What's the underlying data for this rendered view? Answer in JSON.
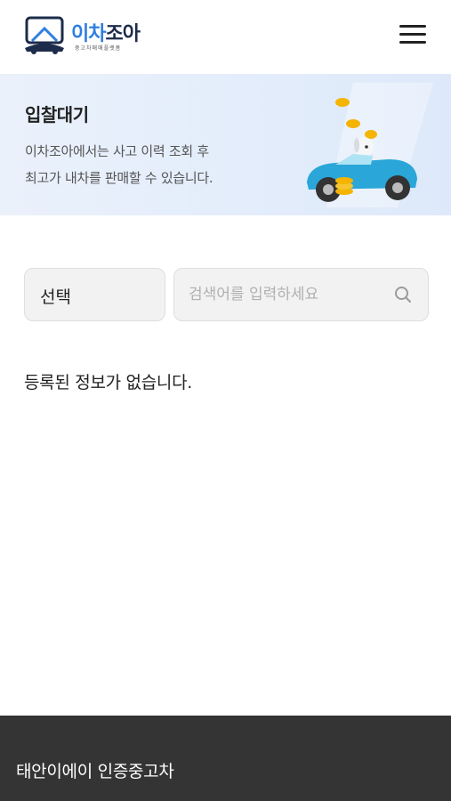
{
  "header": {
    "logo": {
      "text_part1": "이차",
      "text_part2": "조아",
      "tagline": "중고차매매플랫폼"
    },
    "menu_icon": "hamburger-menu-icon"
  },
  "banner": {
    "title": "입찰대기",
    "desc_line1": "이차조아에서는 사고 이력 조회 후",
    "desc_line2": "최고가 내차를 판매할 수 있습니다.",
    "illustration": "car-with-dog-and-coins"
  },
  "search": {
    "select_value": "선택",
    "input_value": "",
    "placeholder": "검색어를 입력하세요",
    "icon": "search-icon"
  },
  "content": {
    "empty_message": "등록된 정보가 없습니다."
  },
  "footer": {
    "title": "태안이에이 인증중고차"
  },
  "colors": {
    "brand_blue": "#2f7fe0",
    "brand_navy": "#1d2c4a",
    "banner_bg": "#e3edfb",
    "footer_bg": "#343434"
  }
}
